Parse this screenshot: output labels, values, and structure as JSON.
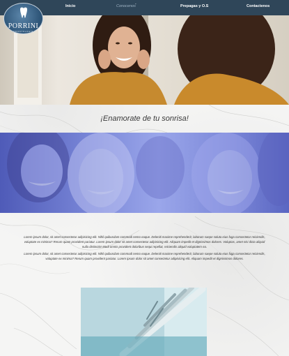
{
  "nav": {
    "items": [
      {
        "label": "Inicio"
      },
      {
        "label": "Conocenos"
      },
      {
        "label": "Prepagas y O.S"
      },
      {
        "label": "Contactenos"
      }
    ]
  },
  "logo": {
    "name": "PORRINI",
    "subtitle": "ODONTOLOGÍA"
  },
  "tagline": "¡Enamorate de tu sonrisa!",
  "content": {
    "paragraph1": "Lorem ipsum dolor, sit amet consectetur adipisicing elit. Nihil quibusdam commodi nemo eaque. Deleniti maxime reprehenderit, laborum saepe soluta eius fuga consectetur reiciendis, voluptate ex minima? Rerum quam provident pariatur. Lorem ipsum dolor sit amet consectetur adipisicing elit. Aliquam impedit et dignissimos dolores. Voluptas, amet nisi dicta aliquid nulla distinctio! Modi omnis provident doloribus sequi repellat, reiciendis aliquid voluptatem ea.",
    "paragraph2": "Lorem ipsum dolor, sit amet consectetur adipisicing elit. Nihil quibusdam commodi nemo eaque. Deleniti maxime reprehenderit, laborum saepe soluta eius fuga consectetur reiciendis, voluptate ex minima? Rerum quam provident pariatur. Lorem ipsum dolor sit amet consectetur adipisicing elit. Aliquam impedit et dignissimos dolores."
  },
  "colors": {
    "navbar": "#2f4659",
    "banner": "#7784d6"
  }
}
